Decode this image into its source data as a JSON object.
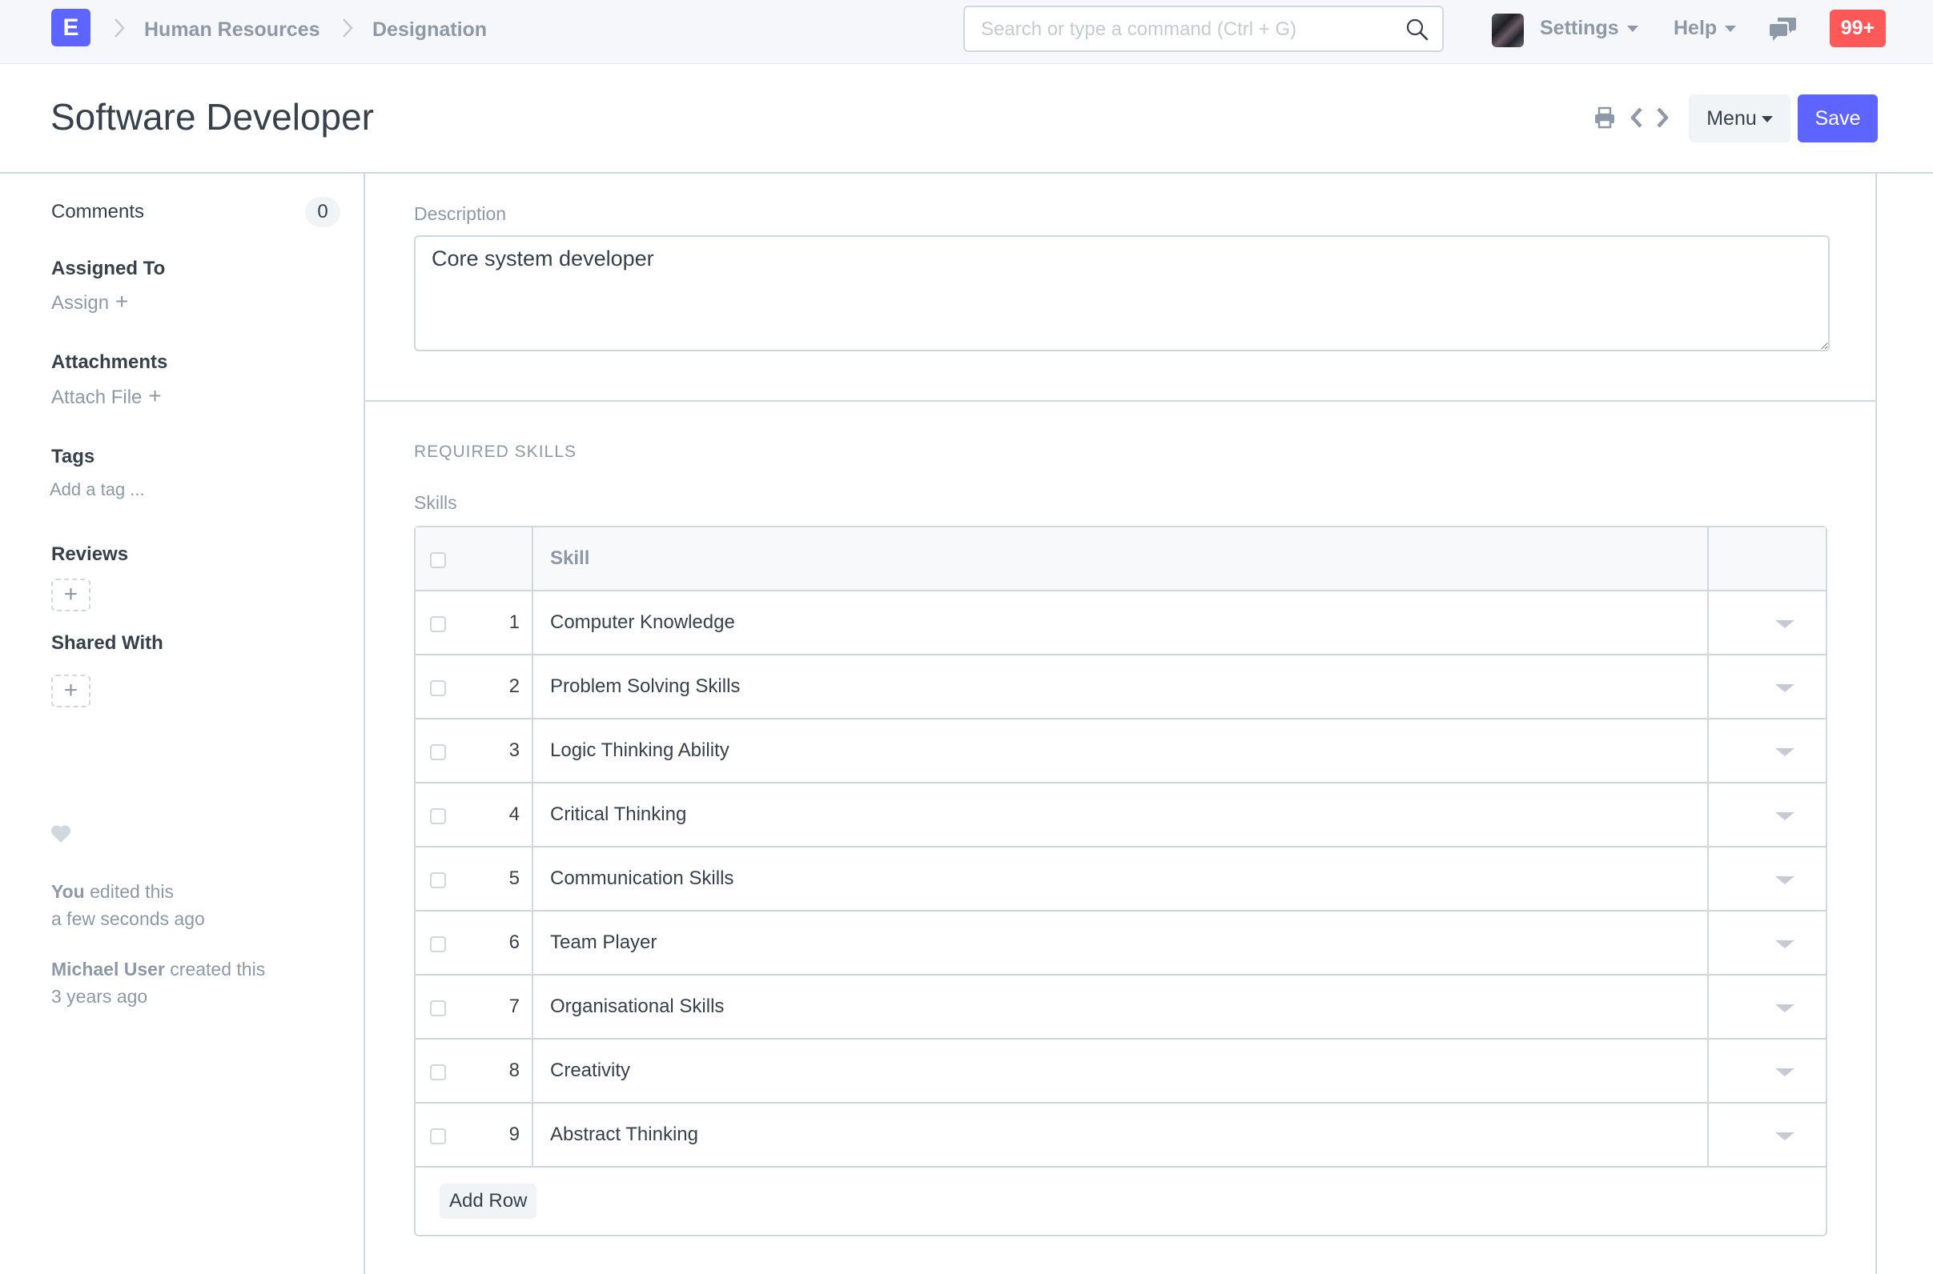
{
  "navbar": {
    "logo_letter": "E",
    "breadcrumbs": [
      "Human Resources",
      "Designation"
    ],
    "search_placeholder": "Search or type a command (Ctrl + G)",
    "search_value": "",
    "settings_label": "Settings",
    "help_label": "Help",
    "notification_count": "99+",
    "accent_color": "#5e64ff",
    "notification_color": "#ff5858"
  },
  "page": {
    "title": "Software Developer",
    "menu_label": "Menu",
    "save_label": "Save"
  },
  "sidebar": {
    "comments_label": "Comments",
    "comments_count": "0",
    "assigned_to_label": "Assigned To",
    "assign_link": "Assign",
    "attachments_label": "Attachments",
    "attach_link": "Attach File",
    "tags_label": "Tags",
    "tags_placeholder": "Add a tag ...",
    "reviews_label": "Reviews",
    "shared_with_label": "Shared With",
    "activity": [
      {
        "user": "You",
        "action": "edited this",
        "time": "a few seconds ago"
      },
      {
        "user": "Michael User",
        "action": "created this",
        "time": "3 years ago"
      }
    ]
  },
  "form": {
    "description_label": "Description",
    "description_value": "Core system developer",
    "section_title": "REQUIRED SKILLS",
    "skills_label": "Skills",
    "skills_header": "Skill",
    "skills": [
      {
        "idx": "1",
        "skill": "Computer Knowledge"
      },
      {
        "idx": "2",
        "skill": "Problem Solving Skills"
      },
      {
        "idx": "3",
        "skill": "Logic Thinking Ability"
      },
      {
        "idx": "4",
        "skill": "Critical Thinking"
      },
      {
        "idx": "5",
        "skill": "Communication Skills"
      },
      {
        "idx": "6",
        "skill": "Team Player"
      },
      {
        "idx": "7",
        "skill": "Organisational Skills"
      },
      {
        "idx": "8",
        "skill": "Creativity"
      },
      {
        "idx": "9",
        "skill": "Abstract Thinking"
      }
    ],
    "add_row_label": "Add Row"
  }
}
